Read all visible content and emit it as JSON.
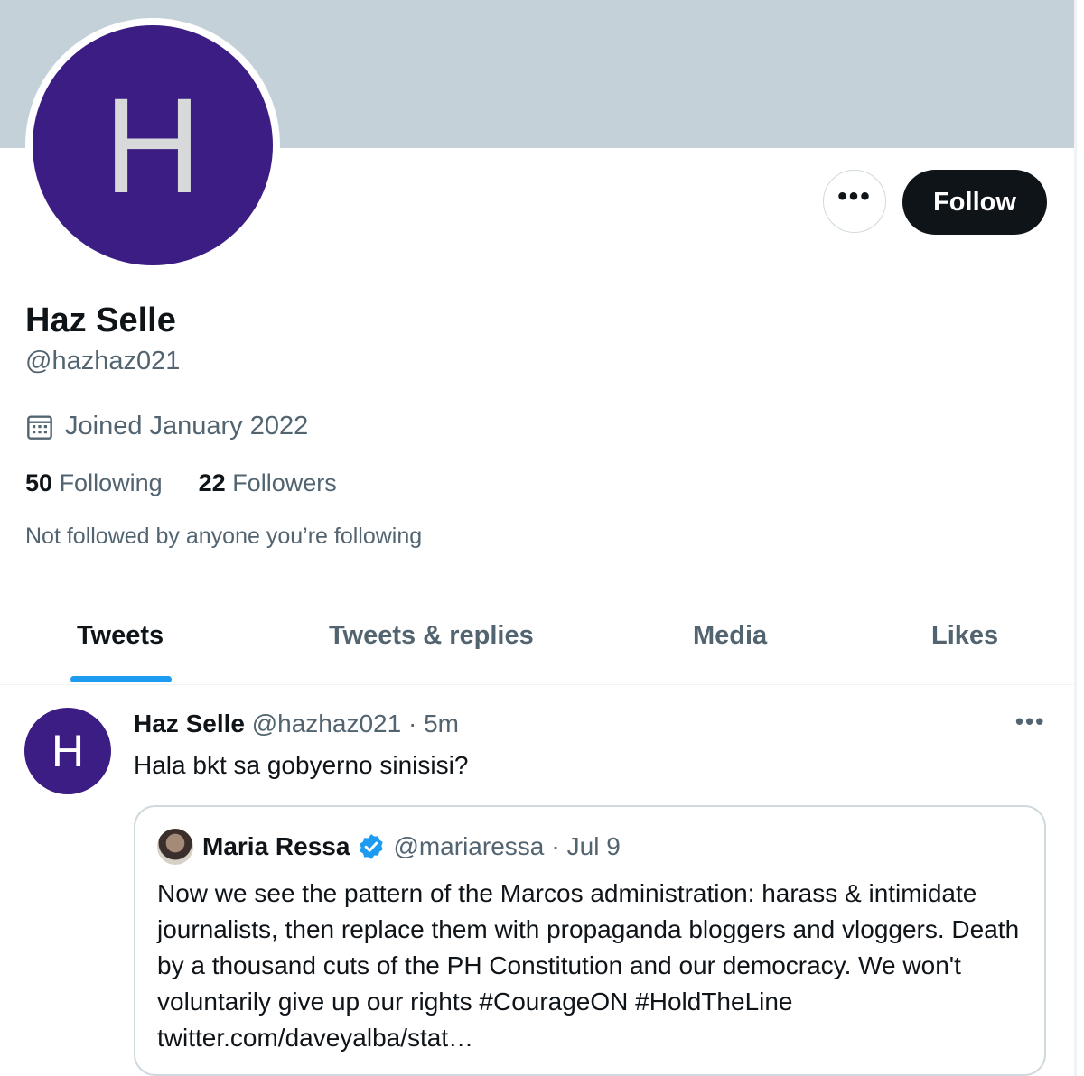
{
  "profile": {
    "avatar_letter": "H",
    "display_name": "Haz Selle",
    "handle": "@hazhaz021",
    "joined": "Joined January 2022",
    "following_count": "50",
    "following_label": "Following",
    "followers_count": "22",
    "followers_label": "Followers",
    "not_followed_text": "Not followed by anyone you’re following"
  },
  "actions": {
    "more_label": "•••",
    "follow_label": "Follow"
  },
  "tabs": [
    {
      "label": "Tweets",
      "active": true
    },
    {
      "label": "Tweets & replies",
      "active": false
    },
    {
      "label": "Media",
      "active": false
    },
    {
      "label": "Likes",
      "active": false
    }
  ],
  "tweet": {
    "avatar_letter": "H",
    "name": "Haz Selle",
    "handle": "@hazhaz021",
    "separator": "·",
    "time": "5m",
    "more_label": "•••",
    "text": "Hala bkt sa gobyerno sinisisi?",
    "quote": {
      "name": "Maria Ressa",
      "handle": "@mariaressa",
      "separator": "·",
      "date": "Jul 9",
      "text": "Now we see the pattern of the Marcos administration: harass & intimidate journalists, then replace them with propaganda bloggers and vloggers. Death by a thousand cuts of the PH Constitution and our democracy. We won't voluntarily give up our rights #CourageON #HoldTheLine twitter.com/daveyalba/stat…"
    }
  },
  "colors": {
    "banner": "#c5d1d8",
    "avatar_bg": "#3b1d83",
    "accent": "#1d9bf0",
    "text_primary": "#0f1419",
    "text_secondary": "#536471"
  },
  "icons": {
    "calendar": "calendar-icon",
    "verified": "verified-badge-icon",
    "more": "more-horizontal-icon"
  }
}
